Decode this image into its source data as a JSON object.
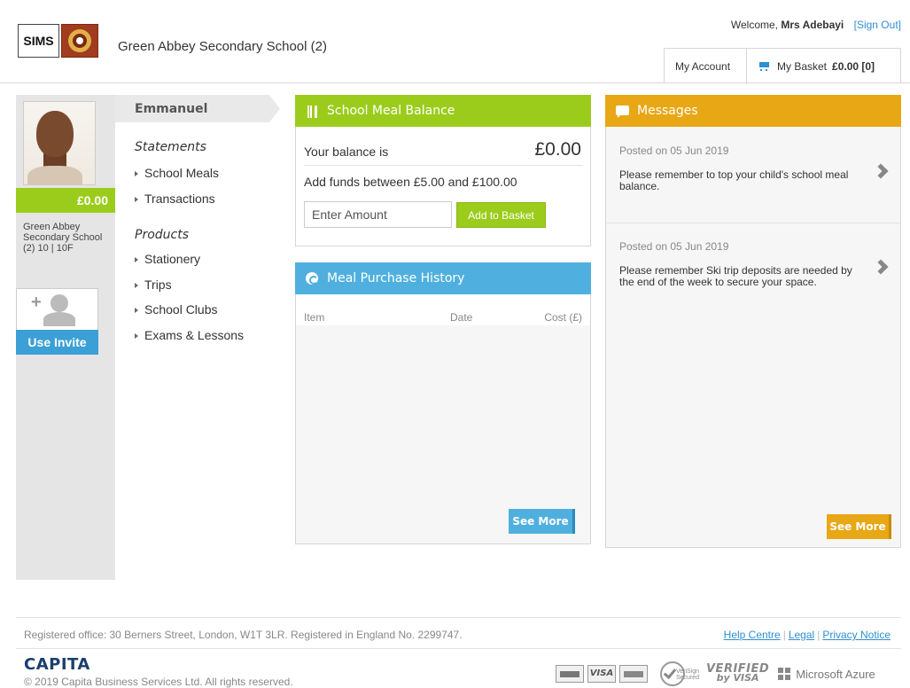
{
  "header": {
    "logo_text": "SIMS",
    "school_name": "Green Abbey Secondary School (2)",
    "welcome_prefix": "Welcome, ",
    "user_name": "Mrs Adebayi",
    "sign_out": "[Sign Out]",
    "my_account": "My Account",
    "my_basket": "My Basket",
    "basket_amount": "£0.00 [0]"
  },
  "sidebar": {
    "balance": "£0.00",
    "school_info": "Green Abbey Secondary School (2) 10 | 10F",
    "invite_label": "Use Invite"
  },
  "nav": {
    "child_name": "Emmanuel",
    "statements_heading": "Statements",
    "statements": [
      "School Meals",
      "Transactions"
    ],
    "products_heading": "Products",
    "products": [
      "Stationery",
      "Trips",
      "School Clubs",
      "Exams & Lessons"
    ]
  },
  "meal_balance": {
    "title": "School Meal Balance",
    "balance_label": "Your balance is",
    "balance_amount": "£0.00",
    "funds_text": "Add funds between £5.00 and £100.00",
    "amount_placeholder": "Enter Amount",
    "add_button": "Add to Basket"
  },
  "meal_history": {
    "title": "Meal Purchase History",
    "columns": [
      "Item",
      "Date",
      "Cost (£)"
    ],
    "see_more": "See More"
  },
  "messages": {
    "title": "Messages",
    "items": [
      {
        "date": "Posted on 05 Jun 2019",
        "text": "Please remember to top your child's school meal balance."
      },
      {
        "date": "Posted on 05 Jun 2019",
        "text": "Please remember Ski trip deposits are needed by the end of the week to secure your space."
      }
    ],
    "see_more": "See More"
  },
  "footer": {
    "registered_office": "Registered office: 30 Berners Street, London, W1T 3LR. Registered in England No. 2299747.",
    "links": [
      "Help Centre",
      "Legal",
      "Privacy Notice"
    ],
    "capita": "CAPITA",
    "copyright": "© 2019 Capita Business Services Ltd. All rights reserved.",
    "visa_label": "VISA",
    "verisign_label": "VeriSign Secured",
    "vbv_line1": "VERIFIED",
    "vbv_line2": "by VISA",
    "azure_label": "Microsoft Azure"
  },
  "icons": {
    "cart": "basket-icon",
    "meal": "fork-knife-icon",
    "history": "copyright-coin-icon",
    "messages": "chat-bubble-icon",
    "message_open": "chevron-right-icon"
  },
  "colors": {
    "green_accent": "#9bcc1c",
    "blue_accent": "#4fb0df",
    "orange_accent": "#e8a715",
    "link_blue": "#2f8fd0"
  }
}
